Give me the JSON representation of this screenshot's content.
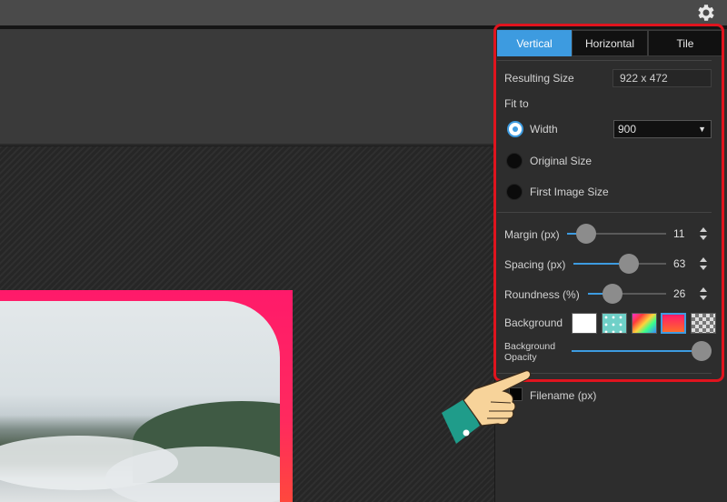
{
  "tabs": {
    "vertical": "Vertical",
    "horizontal": "Horizontal",
    "tile": "Tile",
    "active": "Vertical"
  },
  "resulting_size": {
    "label": "Resulting Size",
    "value": "922 x 472"
  },
  "fit_to": {
    "label": "Fit to",
    "options": [
      {
        "label": "Width",
        "selected": true
      },
      {
        "label": "Original Size",
        "selected": false
      },
      {
        "label": "First Image Size",
        "selected": false
      }
    ],
    "width_value": "900"
  },
  "sliders": {
    "margin": {
      "label": "Margin (px)",
      "value": "11",
      "level": 0.05
    },
    "spacing": {
      "label": "Spacing (px)",
      "value": "63",
      "level": 0.6
    },
    "roundness": {
      "label": "Roundness (%)",
      "value": "26",
      "level": 0.26
    }
  },
  "background": {
    "label": "Background",
    "swatches": [
      "white",
      "teal-dots",
      "rainbow",
      "pink-orange-gradient",
      "transparent-checker"
    ],
    "selected": "pink-orange-gradient",
    "opacity_label": "Background Opacity",
    "opacity_level": 1.0
  },
  "filename": {
    "label": "Filename (px)",
    "checked": false
  },
  "colors": {
    "accent": "#3d9be0",
    "highlight": "#e0141e",
    "frame": "#ff1a6a"
  },
  "icons": {
    "settings": "gear-icon",
    "pointer": "pointing-hand-icon"
  }
}
